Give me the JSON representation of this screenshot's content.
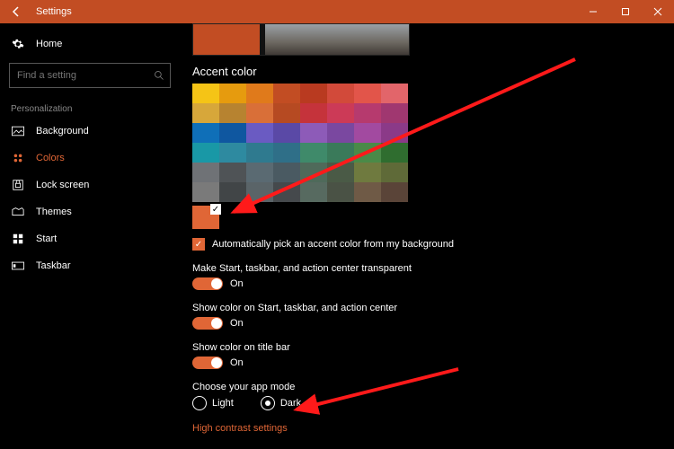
{
  "titlebar": {
    "title": "Settings"
  },
  "sidebar": {
    "home": "Home",
    "search_placeholder": "Find a setting",
    "group": "Personalization",
    "items": [
      "Background",
      "Colors",
      "Lock screen",
      "Themes",
      "Start",
      "Taskbar"
    ],
    "active_index": 1
  },
  "accent": {
    "heading": "Accent color",
    "auto_label": "Automatically pick an accent color from my background",
    "rows": [
      [
        "#f5c416",
        "#e69b0e",
        "#e07a1b",
        "#c24d23",
        "#b93a20",
        "#d24a3a",
        "#e2554a",
        "#e2656a"
      ],
      [
        "#d7a73a",
        "#b78330",
        "#d96f38",
        "#b64a22",
        "#c5333b",
        "#cc3a57",
        "#b63a6e",
        "#a03770"
      ],
      [
        "#0f6fb8",
        "#0f57a0",
        "#6a5bc2",
        "#5a49a6",
        "#8d5bb8",
        "#7a48a0",
        "#a24aa0",
        "#8b3a88"
      ],
      [
        "#1998a6",
        "#2e8aa0",
        "#2f7a8f",
        "#2f6f88",
        "#3f8a6a",
        "#3a7a5a",
        "#4a8a48",
        "#2f6d2f"
      ],
      [
        "#6f7276",
        "#4f5356",
        "#5a6a72",
        "#4a5a62",
        "#4f6a5a",
        "#4a5a46",
        "#6f7a3f",
        "#5f6a38"
      ],
      [
        "#7a7a7a",
        "#414547",
        "#5a6468",
        "#45494c",
        "#576a60",
        "#4a5245",
        "#6f5a46",
        "#5a4438"
      ]
    ],
    "selected": "#e06636"
  },
  "options": {
    "transparent": {
      "label": "Make Start, taskbar, and action center transparent",
      "state": "On"
    },
    "show_color": {
      "label": "Show color on Start, taskbar, and action center",
      "state": "On"
    },
    "titlebar": {
      "label": "Show color on title bar",
      "state": "On"
    }
  },
  "app_mode": {
    "label": "Choose your app mode",
    "light": "Light",
    "dark": "Dark",
    "selected": "dark"
  },
  "link": "High contrast settings"
}
